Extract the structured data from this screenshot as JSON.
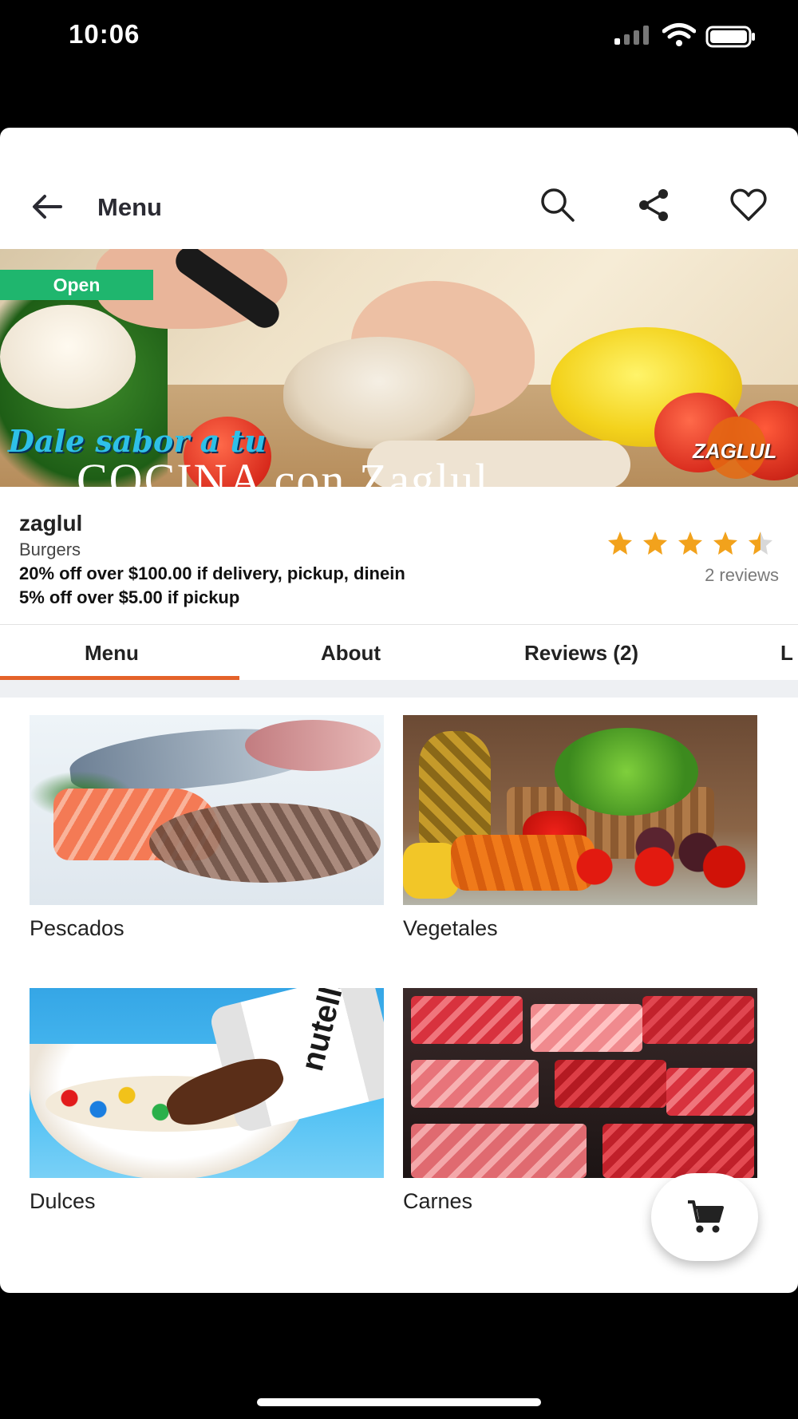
{
  "status_bar": {
    "time": "10:06"
  },
  "app_bar": {
    "title": "Menu",
    "icons": [
      "back-arrow-icon",
      "search-icon",
      "share-icon",
      "heart-icon"
    ]
  },
  "banner": {
    "badge": "Open",
    "caption_line1": "Dale sabor a tu",
    "caption_line2": "COCINA con Zaglul",
    "logo": "ZAGLUL",
    "badge_color": "#1fb66e"
  },
  "store": {
    "name": "zaglul",
    "category": "Burgers",
    "promos": [
      "20% off over $100.00 if delivery, pickup, dinein",
      "5% off over $5.00 if pickup"
    ],
    "rating": 4.5,
    "reviews_label": "2 reviews",
    "star_color": "#f2a21c"
  },
  "tabs": [
    {
      "label": "Menu",
      "active": true
    },
    {
      "label": "About",
      "active": false
    },
    {
      "label": "Reviews (2)",
      "active": false
    },
    {
      "label": "L",
      "active": false
    }
  ],
  "accent_color": "#e4622a",
  "categories": [
    {
      "label": "Pescados"
    },
    {
      "label": "Vegetales"
    },
    {
      "label": "Dulces",
      "jar_text": "nutella"
    },
    {
      "label": "Carnes"
    }
  ],
  "cart": {
    "icon": "cart-icon"
  }
}
